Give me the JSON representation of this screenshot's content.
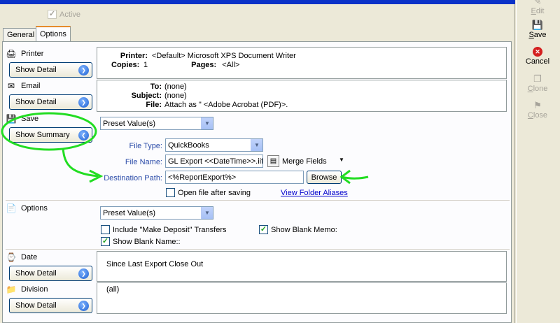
{
  "header": {
    "active_label": "Active"
  },
  "tabs": [
    "General",
    "Options"
  ],
  "printer": {
    "label": "Printer",
    "button": "Show Detail",
    "printer_key": "Printer:",
    "printer_val": "<Default>  Microsoft XPS Document Writer",
    "copies_key": "Copies:",
    "copies_val": "1",
    "pages_key": "Pages:",
    "pages_val": "<All>"
  },
  "email": {
    "label": "Email",
    "button": "Show Detail",
    "to_key": "To:",
    "to_val": "(none)",
    "subject_key": "Subject:",
    "subject_val": "(none)",
    "file_key": "File:",
    "file_val": "Attach as \" <Adobe Acrobat (PDF)>."
  },
  "save": {
    "label": "Save",
    "button": "Show Summary",
    "preset": "Preset Value(s)",
    "file_type_label": "File Type:",
    "file_type_val": "QuickBooks",
    "file_name_label": "File Name:",
    "file_name_val": "GL Export <<DateTime>>.iif",
    "merge_fields": "Merge Fields",
    "dest_label": "Destination Path:",
    "dest_val": "<%ReportExport%>",
    "browse": "Browse",
    "open_after": "Open file after saving",
    "view_aliases": "View Folder Aliases"
  },
  "options": {
    "label": "Options",
    "preset": "Preset Value(s)",
    "include_deposit": "Include \"Make Deposit\" Transfers",
    "show_blank_memo": "Show Blank Memo:",
    "show_blank_name": "Show Blank Name::"
  },
  "date": {
    "label": "Date",
    "button": "Show Detail",
    "value": "Since Last Export Close Out"
  },
  "division": {
    "label": "Division",
    "button": "Show Detail",
    "value": "(all)"
  },
  "right_panel": {
    "edit": "Edit",
    "save": "Save",
    "cancel": "Cancel",
    "clone": "Clone",
    "close": "Close"
  },
  "colors": {
    "annotation": "#22dd22",
    "xp_blue": "#0a32c8"
  }
}
